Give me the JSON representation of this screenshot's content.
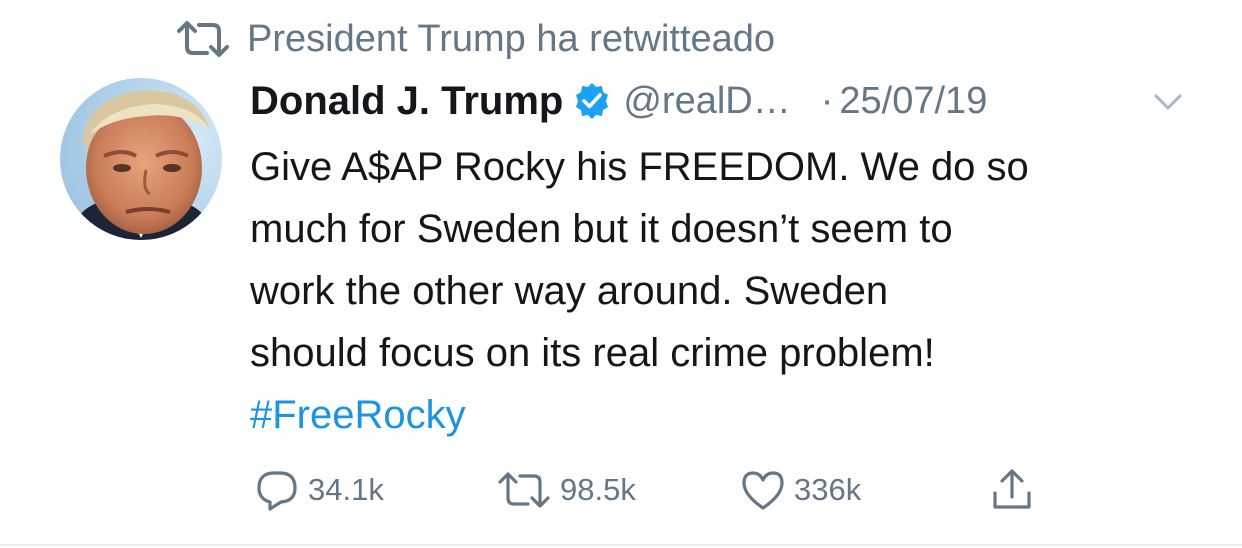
{
  "retweet_context": {
    "text": "President Trump ha retwitteado",
    "icon": "retweet-icon"
  },
  "author": {
    "display_name": "Donald J. Trump",
    "handle": "@realD…",
    "verified": true,
    "avatar": "avatar"
  },
  "meta": {
    "separator": "·",
    "date": "25/07/19"
  },
  "tweet": {
    "lines": [
      "Give A$AP Rocky his FREEDOM. We do so",
      "much for Sweden but it doesn’t seem to",
      "work the other way around. Sweden",
      "should focus on its real crime problem!"
    ],
    "hashtag": "#FreeRocky"
  },
  "actions": {
    "replies": "34.1k",
    "retweets": "98.5k",
    "likes": "336k"
  },
  "colors": {
    "text": "#14171a",
    "secondary": "#657786",
    "accent": "#1b95e0",
    "verified": "#1da1f2"
  }
}
